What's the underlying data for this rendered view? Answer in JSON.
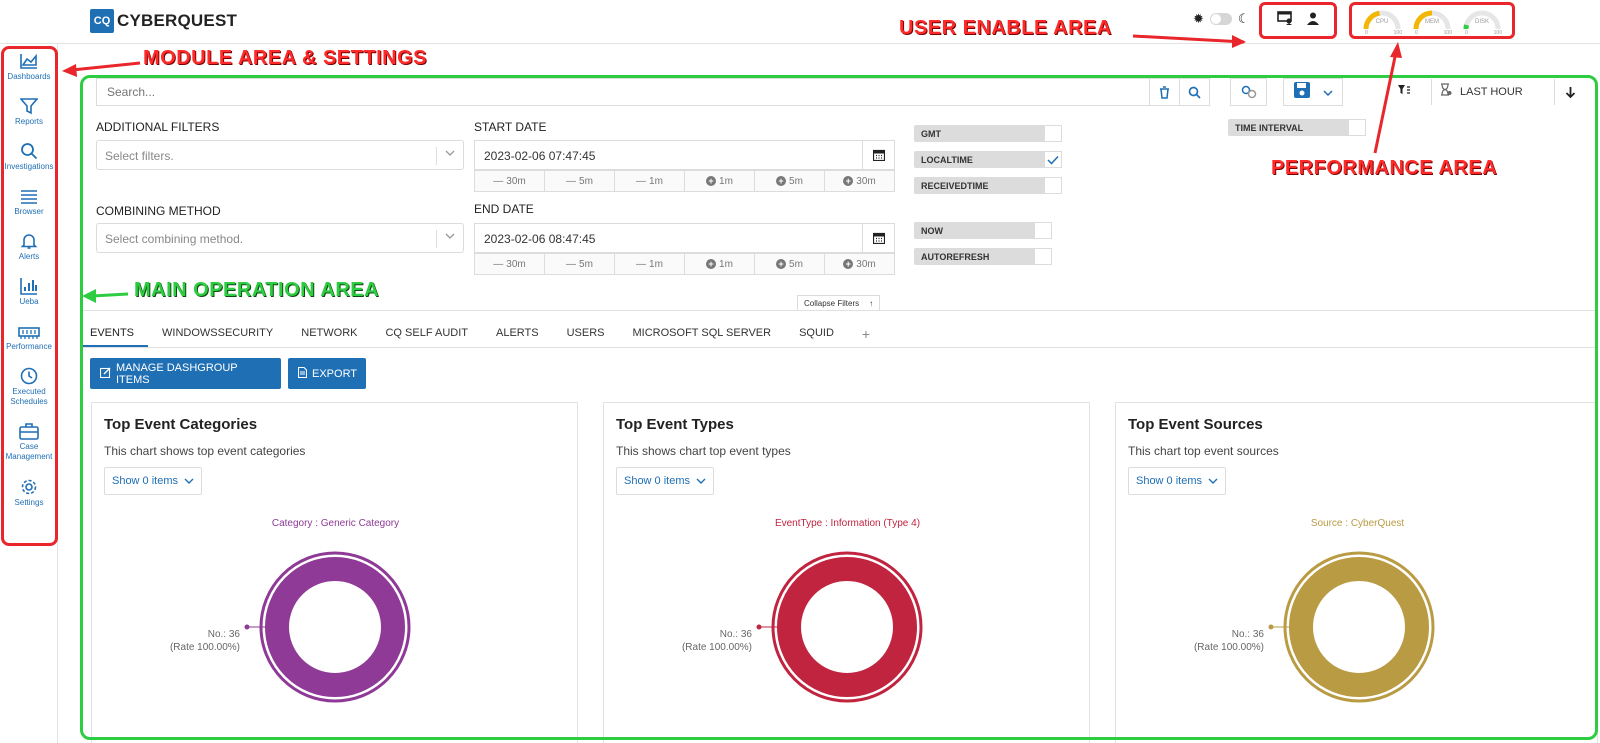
{
  "app": {
    "logo_mark": "CQ",
    "logo_name": "CYBERQUEST"
  },
  "topbar": {
    "theme_icons": [
      "sun-icon",
      "moon-icon"
    ],
    "user_icons": [
      "monitor-user-icon",
      "user-icon"
    ],
    "gauges": [
      {
        "label": "CPU",
        "min": "0",
        "max": "100",
        "value": 0.45
      },
      {
        "label": "MEM",
        "min": "0",
        "max": "100",
        "value": 0.5
      },
      {
        "label": "DISK",
        "min": "0",
        "max": "100",
        "value": 0.08
      }
    ]
  },
  "sidebar": {
    "items": [
      {
        "label": "Dashboards",
        "icon": "chart-area-icon"
      },
      {
        "label": "Reports",
        "icon": "filter-icon"
      },
      {
        "label": "Investigations",
        "icon": "search-icon"
      },
      {
        "label": "Browser",
        "icon": "list-icon"
      },
      {
        "label": "Alerts",
        "icon": "bell-icon"
      },
      {
        "label": "Ueba",
        "icon": "bar-chart-icon"
      },
      {
        "label": "Performance",
        "icon": "memory-icon"
      },
      {
        "label": "Executed Schedules",
        "icon": "clock-icon"
      },
      {
        "label": "Case Management",
        "icon": "briefcase-icon"
      },
      {
        "label": "Settings",
        "icon": "gear-icon"
      }
    ]
  },
  "search": {
    "placeholder": "Search..."
  },
  "toolbar": {
    "time_range": "LAST HOUR"
  },
  "filters": {
    "additional_label": "ADDITIONAL FILTERS",
    "additional_placeholder": "Select filters.",
    "combining_label": "COMBINING METHOD",
    "combining_placeholder": "Select combining method.",
    "start_label": "START DATE",
    "start_value": "2023-02-06 07:47:45",
    "end_label": "END DATE",
    "end_value": "2023-02-06 08:47:45",
    "steps": [
      "30m",
      "5m",
      "1m",
      "1m",
      "5m",
      "30m"
    ],
    "gmt": "GMT",
    "localtime": "LOCALTIME",
    "receivedtime": "RECEIVEDTIME",
    "now": "NOW",
    "autorefresh": "AUTOREFRESH",
    "time_interval": "TIME INTERVAL",
    "collapse": "Collapse Filters"
  },
  "tabs": [
    "EVENTS",
    "WINDOWSSECURITY",
    "NETWORK",
    "CQ SELF AUDIT",
    "ALERTS",
    "USERS",
    "MICROSOFT SQL SERVER",
    "SQUID",
    "+"
  ],
  "actions": {
    "manage": "MANAGE DASHGROUP ITEMS",
    "export": "EXPORT"
  },
  "cards": [
    {
      "title": "Top Event Categories",
      "subtitle": "This chart shows top event categories",
      "show": "Show 0 items",
      "category": "Category : Generic Category",
      "no": "No.: 36",
      "rate": "(Rate 100.00%)",
      "color": "#8e3a96"
    },
    {
      "title": "Top Event Types",
      "subtitle": "This shows chart top event types",
      "show": "Show 0 items",
      "category": "EventType : Information (Type 4)",
      "no": "No.: 36",
      "rate": "(Rate 100.00%)",
      "color": "#c0243f"
    },
    {
      "title": "Top Event Sources",
      "subtitle": "This chart top event sources",
      "show": "Show 0 items",
      "category": "Source : CyberQuest",
      "no": "No.: 36",
      "rate": "(Rate 100.00%)",
      "color": "#b99b44"
    }
  ],
  "annotations": {
    "user_area": "USER ENABLE AREA",
    "module_area": "MODULE AREA & SETTINGS",
    "main_area": "MAIN OPERATION AREA",
    "performance_area": "PERFORMANCE AREA"
  },
  "colors": {
    "accent": "#1f6fb5",
    "annotation_red": "#e8262b",
    "annotation_green": "#2ecc40"
  }
}
